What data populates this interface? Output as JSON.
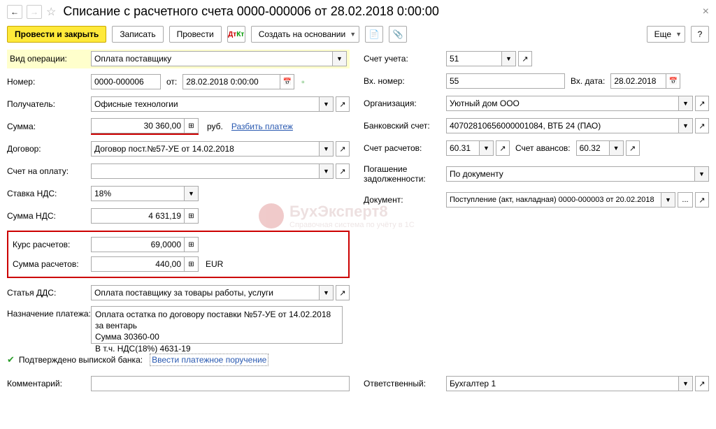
{
  "header": {
    "title": "Списание с расчетного счета 0000-000006 от 28.02.2018 0:00:00"
  },
  "toolbar": {
    "submit_close": "Провести и закрыть",
    "save": "Записать",
    "submit": "Провести",
    "create_based": "Создать на основании",
    "more": "Еще"
  },
  "left": {
    "op_type_label": "Вид операции:",
    "op_type": "Оплата поставщику",
    "number_label": "Номер:",
    "number": "0000-000006",
    "from_label": "от:",
    "date": "28.02.2018  0:00:00",
    "recipient_label": "Получатель:",
    "recipient": "Офисные технологии",
    "sum_label": "Сумма:",
    "sum": "30 360,00",
    "currency": "руб.",
    "split_link": "Разбить платеж",
    "contract_label": "Договор:",
    "contract": "Договор пост.№57-УЕ от 14.02.2018",
    "invoice_label": "Счет на оплату:",
    "vat_rate_label": "Ставка НДС:",
    "vat_rate": "18%",
    "vat_sum_label": "Сумма НДС:",
    "vat_sum": "4 631,19",
    "rate_label": "Курс расчетов:",
    "rate": "69,0000",
    "calc_sum_label": "Сумма расчетов:",
    "calc_sum": "440,00",
    "calc_currency": "EUR",
    "dds_label": "Статья ДДС:",
    "dds": "Оплата поставщику за товары работы, услуги",
    "purpose_label": "Назначение платежа:",
    "purpose": "Оплата остатка по договору поставки №57-УЕ от 14.02.2018 за вентарь\nСумма 30360-00\nВ т.ч. НДС(18%) 4631-19",
    "confirmed_label": "Подтверждено выпиской банка:",
    "enter_order": "Ввести платежное поручение",
    "comment_label": "Комментарий:"
  },
  "right": {
    "account_label": "Счет учета:",
    "account": "51",
    "in_number_label": "Вх. номер:",
    "in_number": "55",
    "in_date_label": "Вх. дата:",
    "in_date": "28.02.2018",
    "org_label": "Организация:",
    "org": "Уютный дом ООО",
    "bank_acc_label": "Банковский счет:",
    "bank_acc": "40702810656000001084, ВТБ 24 (ПАО)",
    "settle_acc_label": "Счет расчетов:",
    "settle_acc": "60.31",
    "advance_acc_label": "Счет авансов:",
    "advance_acc": "60.32",
    "debt_label": "Погашение задолженности:",
    "debt": "По документу",
    "doc_label": "Документ:",
    "doc": "Поступление (акт, накладная) 0000-000003 от 20.02.2018",
    "responsible_label": "Ответственный:",
    "responsible": "Бухгалтер 1"
  },
  "watermark": {
    "title": "БухЭксперт8",
    "sub": "Справочная система по учёту в 1С"
  }
}
